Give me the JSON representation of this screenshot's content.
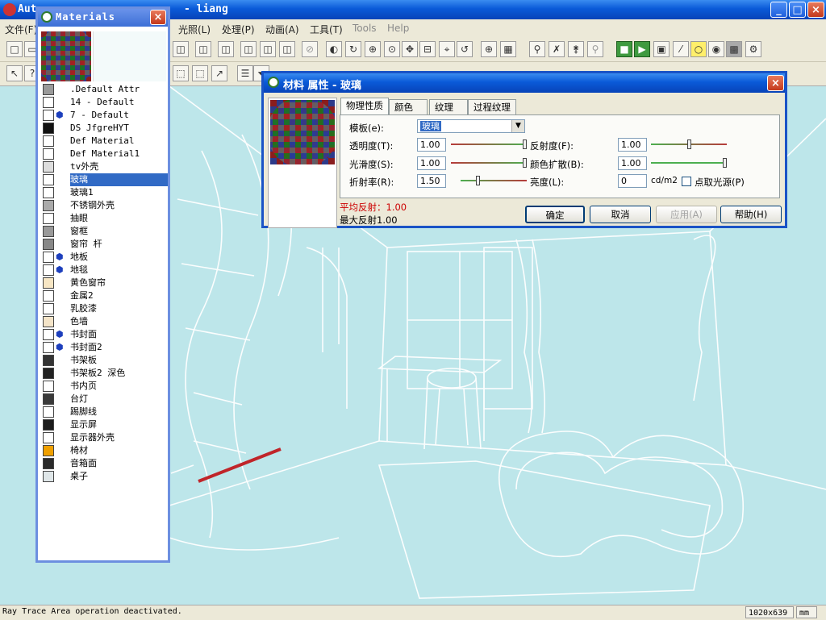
{
  "app": {
    "title_prefix": "Aut",
    "title_suffix": "- liang"
  },
  "menus": [
    {
      "label": "文件(F)",
      "enabled": true
    },
    {
      "label": "光照(L)",
      "enabled": true
    },
    {
      "label": "处理(P)",
      "enabled": true
    },
    {
      "label": "动画(A)",
      "enabled": true
    },
    {
      "label": "工具(T)",
      "enabled": true
    },
    {
      "label": "Tools",
      "enabled": false
    },
    {
      "label": "Help",
      "enabled": false
    }
  ],
  "materials_window": {
    "title": "Materials",
    "items": [
      {
        "name": ".Default Attr",
        "swatch": "#9a9a9a",
        "icon": ""
      },
      {
        "name": "14 - Default",
        "swatch": "#ffffff",
        "icon": ""
      },
      {
        "name": "7 - Default",
        "swatch": "#ffffff",
        "icon": "texture-cube-icon"
      },
      {
        "name": "DS  JfgreHYT",
        "swatch": "#111111",
        "icon": ""
      },
      {
        "name": "Def Material",
        "swatch": "#ffffff",
        "icon": ""
      },
      {
        "name": "Def Material1",
        "swatch": "#ffffff",
        "icon": ""
      },
      {
        "name": "tv外壳",
        "swatch": "#dddddd",
        "icon": ""
      },
      {
        "name": "玻璃",
        "swatch": "#ffffff",
        "icon": ""
      },
      {
        "name": "玻璃1",
        "swatch": "#ffffff",
        "icon": ""
      },
      {
        "name": "不锈钢外壳",
        "swatch": "#aaaaaa",
        "icon": ""
      },
      {
        "name": "抽眼",
        "swatch": "#ffffff",
        "icon": ""
      },
      {
        "name": "窗框",
        "swatch": "#999999",
        "icon": ""
      },
      {
        "name": "窗帘 杆",
        "swatch": "#888888",
        "icon": ""
      },
      {
        "name": "地板",
        "swatch": "#ffffff",
        "icon": "texture-cube-icon"
      },
      {
        "name": "地毯",
        "swatch": "#ffffff",
        "icon": "texture-cube-icon"
      },
      {
        "name": "黄色窗帘",
        "swatch": "#f7e6c4",
        "icon": ""
      },
      {
        "name": "金属2",
        "swatch": "#ffffff",
        "icon": ""
      },
      {
        "name": "乳胶漆",
        "swatch": "#ffffff",
        "icon": ""
      },
      {
        "name": "色墙",
        "swatch": "#f4e4c8",
        "icon": ""
      },
      {
        "name": "书封面",
        "swatch": "#ffffff",
        "icon": "texture-cube-icon"
      },
      {
        "name": "书封面2",
        "swatch": "#ffffff",
        "icon": "texture-cube-icon"
      },
      {
        "name": "书架板",
        "swatch": "#333333",
        "icon": ""
      },
      {
        "name": "书架板2     深色",
        "swatch": "#222222",
        "icon": ""
      },
      {
        "name": "书内页",
        "swatch": "#ffffff",
        "icon": ""
      },
      {
        "name": "台灯",
        "swatch": "#3a3a3a",
        "icon": ""
      },
      {
        "name": "踢脚线",
        "swatch": "#ffffff",
        "icon": ""
      },
      {
        "name": "显示屏",
        "swatch": "#1c1c1c",
        "icon": ""
      },
      {
        "name": "显示器外壳",
        "swatch": "#ffffff",
        "icon": ""
      },
      {
        "name": "椅材",
        "swatch": "#f0a000",
        "icon": ""
      },
      {
        "name": "音箱面",
        "swatch": "#2a2a2a",
        "icon": ""
      },
      {
        "name": "桌子",
        "swatch": "#dfe6e8",
        "icon": ""
      }
    ],
    "selected_index": 7
  },
  "dialog": {
    "title": "材料 属性 - 玻璃",
    "tabs": [
      "物理性质",
      "颜色",
      "纹理",
      "过程纹理"
    ],
    "active_tab": 0,
    "template_label": "模板(e):",
    "template_value": "玻璃",
    "fields": {
      "transparency": {
        "label": "透明度(T):",
        "value": "1.00",
        "level": 1.0
      },
      "smoothness": {
        "label": "光滑度(S):",
        "value": "1.00",
        "level": 1.0
      },
      "refraction": {
        "label": "折射率(R):",
        "value": "1.50",
        "level": 0.25
      },
      "reflectivity": {
        "label": "反射度(F):",
        "value": "1.00",
        "level": 0.5
      },
      "color_diffusion": {
        "label": "颜色扩散(B):",
        "value": "1.00",
        "level": 1.0
      },
      "luminance": {
        "label": "亮度(L):",
        "value": "0",
        "unit": "cd/m2"
      }
    },
    "point_light_label": "点取光源(P)",
    "point_light_checked": false,
    "avg_reflect": "平均反射：1.00",
    "max_reflect": "最大反射1.00",
    "buttons": {
      "ok": "确定",
      "cancel": "取消",
      "apply": "应用(A)",
      "help": "帮助(H)"
    }
  },
  "status": {
    "message": "Ray Trace Area operation deactivated.",
    "resolution": "1020x639",
    "units": "mm"
  },
  "colors": {
    "viewport_bg": "#bde6ea",
    "accent": "#0a5ad8",
    "highlight": "#316ac5",
    "avg_reflect": "#cc0000"
  }
}
